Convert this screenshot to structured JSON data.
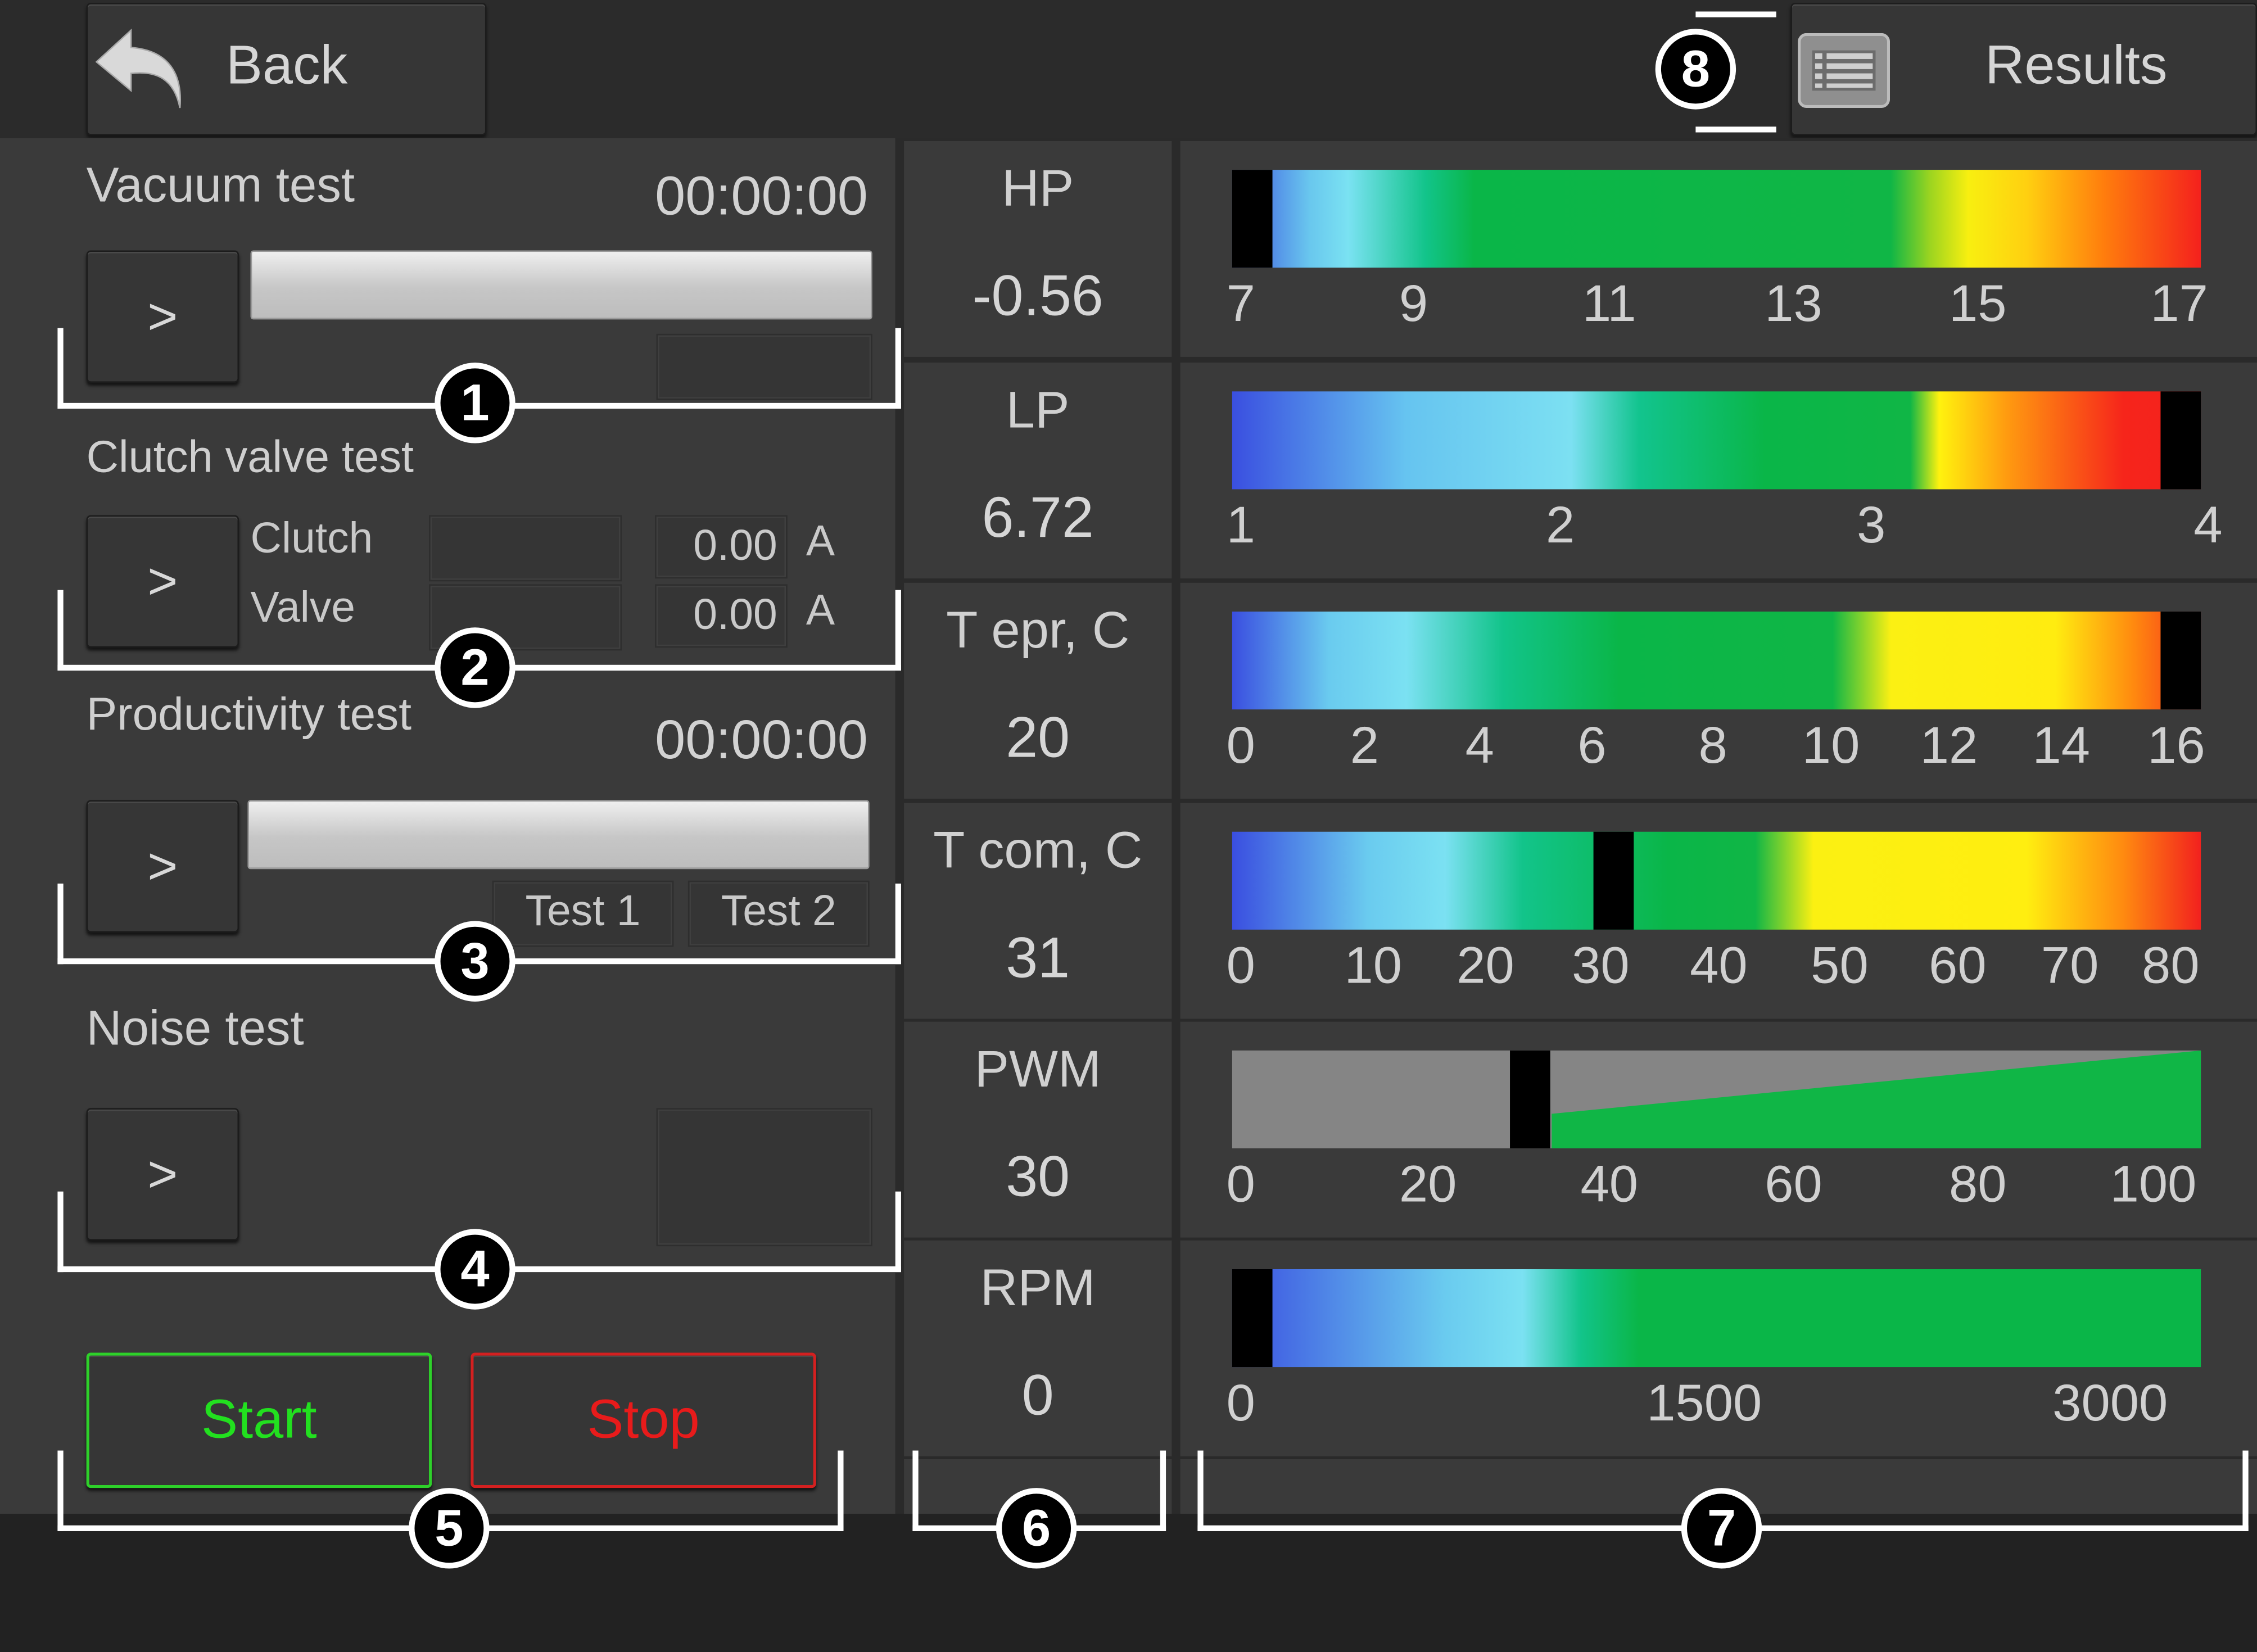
{
  "header": {
    "back_label": "Back",
    "results_label": "Results",
    "back_icon": "undo-arrow-icon",
    "results_icon": "list-icon"
  },
  "tests": {
    "vacuum": {
      "title": "Vacuum test",
      "timer": "00:00:00",
      "run_label": ">"
    },
    "clutch": {
      "title": "Clutch valve test",
      "run_label": ">",
      "clutch_label": "Clutch",
      "valve_label": "Valve",
      "clutch_value": "0.00",
      "valve_value": "0.00",
      "unit": "A"
    },
    "productivity": {
      "title": "Productivity test",
      "timer": "00:00:00",
      "run_label": ">",
      "test1_label": "Test 1",
      "test2_label": "Test 2"
    },
    "noise": {
      "title": "Noise test",
      "run_label": ">"
    }
  },
  "controls": {
    "start_label": "Start",
    "stop_label": "Stop",
    "start_color": "#22e01f",
    "stop_color": "#e81b1b"
  },
  "callouts": [
    "1",
    "2",
    "3",
    "4",
    "5",
    "6",
    "7",
    "8"
  ],
  "gauges": [
    {
      "label": "HP",
      "value": "-0.56",
      "min": 7,
      "max": 17,
      "ticks": [
        "7",
        "9",
        "11",
        "13",
        "15",
        "17"
      ],
      "marker": -0.56
    },
    {
      "label": "LP",
      "value": "6.72",
      "min": 1,
      "max": 4,
      "ticks": [
        "1",
        "2",
        "3",
        "4"
      ],
      "marker": 6.72
    },
    {
      "label": "T epr, C",
      "value": "20",
      "min": 0,
      "max": 16,
      "ticks": [
        "0",
        "2",
        "4",
        "6",
        "8",
        "10",
        "12",
        "14",
        "16"
      ],
      "marker": 20
    },
    {
      "label": "T com, C",
      "value": "31",
      "min": 0,
      "max": 80,
      "ticks": [
        "0",
        "10",
        "20",
        "30",
        "40",
        "50",
        "60",
        "70",
        "80"
      ],
      "marker": 31
    },
    {
      "label": "PWM",
      "value": "30",
      "min": 0,
      "max": 100,
      "ticks": [
        "0",
        "20",
        "40",
        "60",
        "80",
        "100"
      ],
      "marker": 30
    },
    {
      "label": "RPM",
      "value": "0",
      "min": 0,
      "max": 3000,
      "ticks": [
        "0",
        "1500",
        "3000"
      ],
      "marker": 0
    }
  ]
}
